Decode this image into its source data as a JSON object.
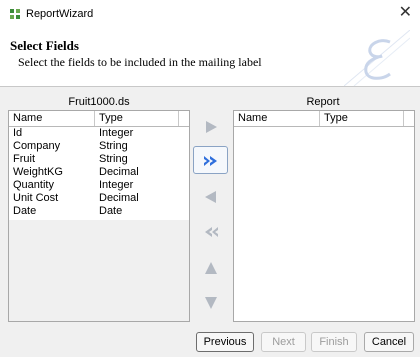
{
  "window": {
    "title": "ReportWizard",
    "close_glyph": "✕"
  },
  "header": {
    "title": "Select Fields",
    "subtitle": "Select the fields to be included in the mailing label"
  },
  "source": {
    "label": "Fruit1000.ds",
    "columns": [
      "Name",
      "Type"
    ],
    "rows": [
      [
        "Id",
        "Integer"
      ],
      [
        "Company",
        "String"
      ],
      [
        "Fruit",
        "String"
      ],
      [
        "WeightKG",
        "Decimal"
      ],
      [
        "Quantity",
        "Integer"
      ],
      [
        "Unit Cost",
        "Decimal"
      ],
      [
        "Date",
        "Date"
      ]
    ]
  },
  "target": {
    "label": "Report",
    "columns": [
      "Name",
      "Type"
    ],
    "rows": []
  },
  "move_buttons": [
    {
      "name": "add-field-button",
      "icon": "arrow-right-icon",
      "active": false
    },
    {
      "name": "add-all-fields-button",
      "icon": "double-arrow-right-icon",
      "active": true
    },
    {
      "name": "remove-field-button",
      "icon": "arrow-left-icon",
      "active": false
    },
    {
      "name": "remove-all-fields-button",
      "icon": "double-arrow-left-icon",
      "active": false
    },
    {
      "name": "move-up-button",
      "icon": "arrow-up-icon",
      "active": false
    },
    {
      "name": "move-down-button",
      "icon": "arrow-down-icon",
      "active": false
    }
  ],
  "footer": {
    "previous": "Previous",
    "next": "Next",
    "finish": "Finish",
    "cancel": "Cancel"
  },
  "colors": {
    "icon_active": "#2f6fdc",
    "icon_disabled": "#b3b9c2"
  }
}
